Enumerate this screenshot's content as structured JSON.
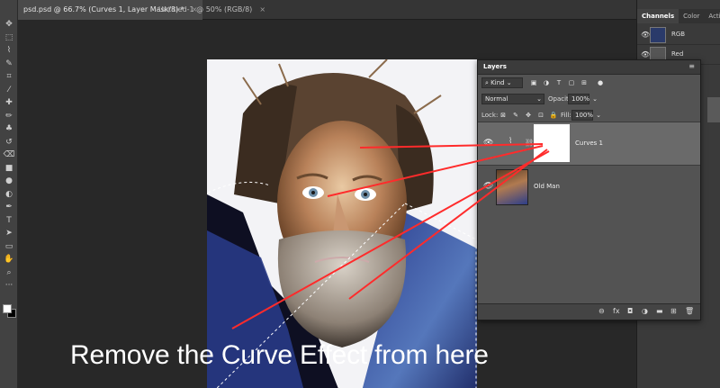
{
  "tabs": [
    {
      "label": "psd.psd @ 66.7% (Curves 1, Layer Mask/8) *",
      "close": "×"
    },
    {
      "label": "Untitled-1 @ 50% (RGB/8)",
      "close": "×"
    }
  ],
  "toolbar": {
    "tools": [
      "move-icon",
      "marquee-icon",
      "lasso-icon",
      "quick-select-icon",
      "crop-icon",
      "eyedropper-icon",
      "healing-icon",
      "brush-icon",
      "stamp-icon",
      "history-brush-icon",
      "eraser-icon",
      "gradient-icon",
      "blur-icon",
      "dodge-icon",
      "pen-icon",
      "type-icon",
      "path-select-icon",
      "rectangle-icon",
      "hand-icon",
      "zoom-icon",
      "more-icon"
    ],
    "glyphs": [
      "✥",
      "⬚",
      "⌇",
      "✎",
      "⌗",
      "⁄",
      "✚",
      "✏",
      "♣",
      "↺",
      "⌫",
      "■",
      "●",
      "◐",
      "✒",
      "T",
      "➤",
      "▭",
      "✋",
      "⌕",
      "···"
    ]
  },
  "channels_panel": {
    "tabs": [
      "Channels",
      "Color",
      "Actions"
    ],
    "rows": [
      {
        "label": "RGB"
      },
      {
        "label": "Red"
      }
    ]
  },
  "layers_panel": {
    "title": "Layers",
    "filter": "Kind",
    "blend_mode": "Normal",
    "opacity_label": "Opacity:",
    "opacity_value": "100%",
    "lock_label": "Lock:",
    "fill_label": "Fill:",
    "fill_value": "100%",
    "layers": [
      {
        "name": "Curves 1",
        "selected": true
      },
      {
        "name": "Old Man",
        "selected": false
      }
    ],
    "footer_icons": [
      "link-icon",
      "fx-icon",
      "mask-icon",
      "adjustment-icon",
      "group-icon",
      "new-layer-icon",
      "trash-icon"
    ],
    "footer_glyphs": [
      "⊖",
      "fx",
      "◘",
      "◑",
      "▬",
      "⊞",
      "🗑"
    ]
  },
  "annotation": {
    "text": "Remove the Curve Effect from here",
    "color": "#ff2b2b"
  },
  "colors": {
    "panel_bg": "#535353",
    "workspace": "#282828",
    "selected_layer": "#6a6a6a"
  }
}
